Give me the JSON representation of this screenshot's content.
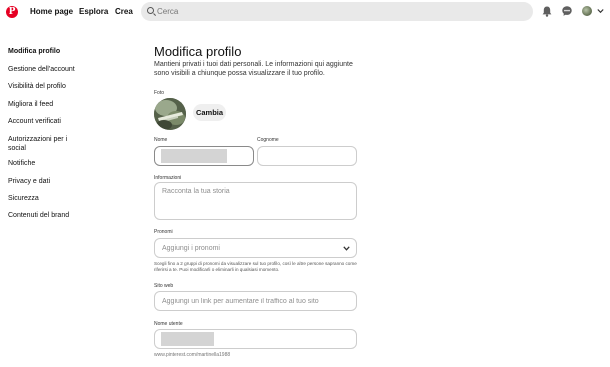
{
  "header": {
    "logo_letter": "P",
    "nav": {
      "home": "Home page",
      "explore": "Esplora",
      "create": "Crea"
    },
    "search_placeholder": "Cerca"
  },
  "sidebar": {
    "items": [
      {
        "label": "Modifica profilo",
        "active": true
      },
      {
        "label": "Gestione dell'account"
      },
      {
        "label": "Visibilità del profilo"
      },
      {
        "label": "Migliora il feed"
      },
      {
        "label": "Account verificati"
      },
      {
        "label": "Autorizzazioni per i social"
      },
      {
        "label": "Notifiche"
      },
      {
        "label": "Privacy e dati"
      },
      {
        "label": "Sicurezza"
      },
      {
        "label": "Contenuti del brand"
      }
    ]
  },
  "main": {
    "title": "Modifica profilo",
    "subtitle": "Mantieni privati i tuoi dati personali. Le informazioni qui aggiunte sono visibili a chiunque possa visualizzare il tuo profilo.",
    "photo": {
      "label": "Foto",
      "change_button": "Cambia"
    },
    "first_name": {
      "label": "Nome",
      "value": ""
    },
    "last_name": {
      "label": "Cognome",
      "value": ""
    },
    "about": {
      "label": "Informazioni",
      "placeholder": "Racconta la tua storia"
    },
    "pronouns": {
      "label": "Pronomi",
      "placeholder": "Aggiungi i pronomi",
      "help": "Scegli fino a 2 gruppi di pronomi da visualizzare sul tuo profilo, così le altre persone sapranno come riferirsi a te. Puoi modificarli o eliminarli in qualsiasi momento."
    },
    "website": {
      "label": "Sito web",
      "placeholder": "Aggiungi un link per aumentare il traffico al tuo sito"
    },
    "username": {
      "label": "Nome utente",
      "url_hint": "www.pinterest.com/martinella1988"
    }
  },
  "colors": {
    "brand": "#e60023",
    "field_border": "#cdcdcd",
    "search_bg": "#e9e9e9"
  },
  "icons": [
    "pinterest-logo-icon",
    "search-icon",
    "bell-icon",
    "chat-icon",
    "avatar",
    "chevron-down-icon"
  ]
}
